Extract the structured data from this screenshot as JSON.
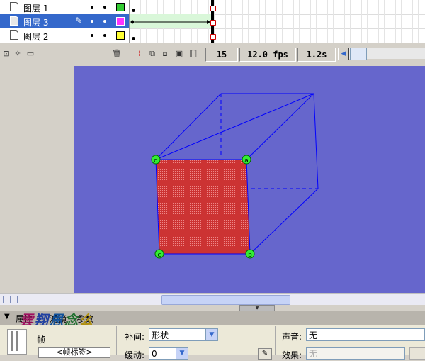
{
  "layers": [
    {
      "name": "图层 1",
      "color": "#33cc33",
      "selected": false
    },
    {
      "name": "图层 3",
      "color": "#ff33ff",
      "selected": true
    },
    {
      "name": "图层 2",
      "color": "#ffff33",
      "selected": false
    }
  ],
  "timeline": {
    "current_frame": "15",
    "frame_rate": "12.0 fps",
    "elapsed_time": "1.2s"
  },
  "stage": {
    "background_color": "#6666cc",
    "shape_fill_color": "#cc3333",
    "outline_color": "#0000ff",
    "corner_labels": [
      "d",
      "a",
      "c",
      "b"
    ]
  },
  "properties": {
    "tabs": [
      "属性",
      "滤镜",
      "参数"
    ],
    "frame_label": "帧",
    "frame_label_input": "<帧标签>",
    "tween_label": "补间:",
    "tween_value": "形状",
    "ease_label": "缓动:",
    "ease_value": "0",
    "sound_label": "声音:",
    "sound_value": "无",
    "effect_label": "效果:",
    "effect_value": "无"
  },
  "watermark": {
    "text": "雲翔思念么"
  }
}
